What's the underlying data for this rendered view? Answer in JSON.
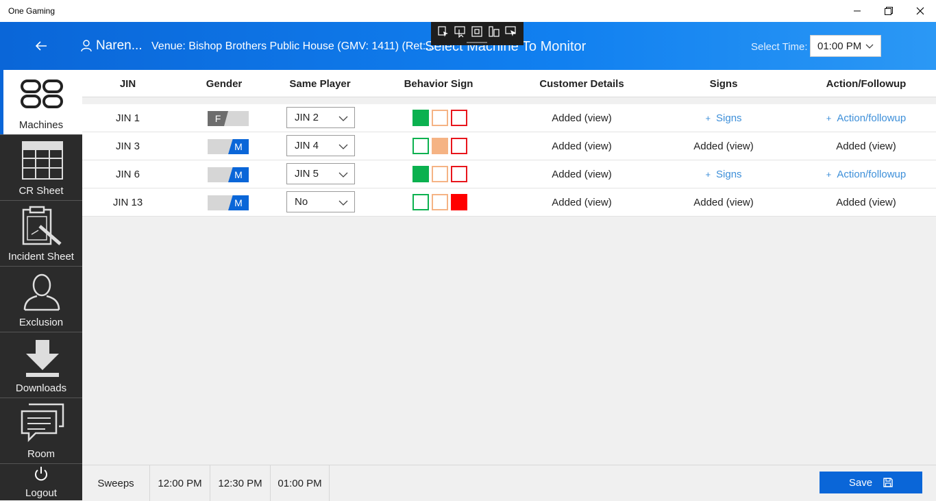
{
  "window": {
    "title": "One Gaming"
  },
  "header": {
    "user_name": "Naren...",
    "venue": "Venue: Bishop Brothers Public House (GMV: 1411) (Ret:...",
    "page_title": "Select Machine To Monitor",
    "select_time_label": "Select Time:",
    "select_time_value": "01:00 PM"
  },
  "sidebar": {
    "items": [
      {
        "label": "Machines",
        "icon": "machines-icon",
        "active": true
      },
      {
        "label": "CR Sheet",
        "icon": "cr-sheet-icon"
      },
      {
        "label": "Incident Sheet",
        "icon": "incident-sheet-icon"
      },
      {
        "label": "Exclusion",
        "icon": "person-icon"
      },
      {
        "label": "Downloads",
        "icon": "download-icon"
      },
      {
        "label": "Room",
        "icon": "chat-icon"
      },
      {
        "label": "Logout",
        "icon": "power-icon"
      }
    ]
  },
  "table": {
    "headers": [
      "JIN",
      "Gender",
      "Same Player",
      "Behavior Sign",
      "Customer Details",
      "Signs",
      "Action/Followup"
    ],
    "rows": [
      {
        "jin": "JIN 1",
        "gender": "F",
        "same_player": "JIN 2",
        "behavior": [
          "filled",
          "empty",
          "empty"
        ],
        "customer": "Added (view)",
        "signs": "Signs",
        "signs_is_link": true,
        "action": "Action/followup",
        "action_is_link": true
      },
      {
        "jin": "JIN 3",
        "gender": "M",
        "same_player": "JIN 4",
        "behavior": [
          "empty",
          "filled",
          "empty"
        ],
        "customer": "Added (view)",
        "signs": "Added (view)",
        "signs_is_link": false,
        "action": "Added (view)",
        "action_is_link": false
      },
      {
        "jin": "JIN 6",
        "gender": "M",
        "same_player": "JIN 5",
        "behavior": [
          "filled",
          "empty",
          "empty"
        ],
        "customer": "Added (view)",
        "signs": "Signs",
        "signs_is_link": true,
        "action": "Action/followup",
        "action_is_link": true
      },
      {
        "jin": "JIN 13",
        "gender": "M",
        "same_player": "No",
        "behavior": [
          "empty",
          "empty",
          "filled"
        ],
        "customer": "Added (view)",
        "signs": "Added (view)",
        "signs_is_link": false,
        "action": "Added (view)",
        "action_is_link": false
      }
    ],
    "behavior_colors": {
      "green": "#0bb14f",
      "orange": "#f5b384",
      "red": "#e8151b"
    }
  },
  "footer": {
    "tabs": [
      "Sweeps",
      "12:00 PM",
      "12:30 PM",
      "01:00 PM"
    ],
    "save_label": "Save"
  },
  "colors": {
    "accent": "#0a66d8",
    "sidebar": "#2b2b2b",
    "link": "#3d8fd9"
  }
}
